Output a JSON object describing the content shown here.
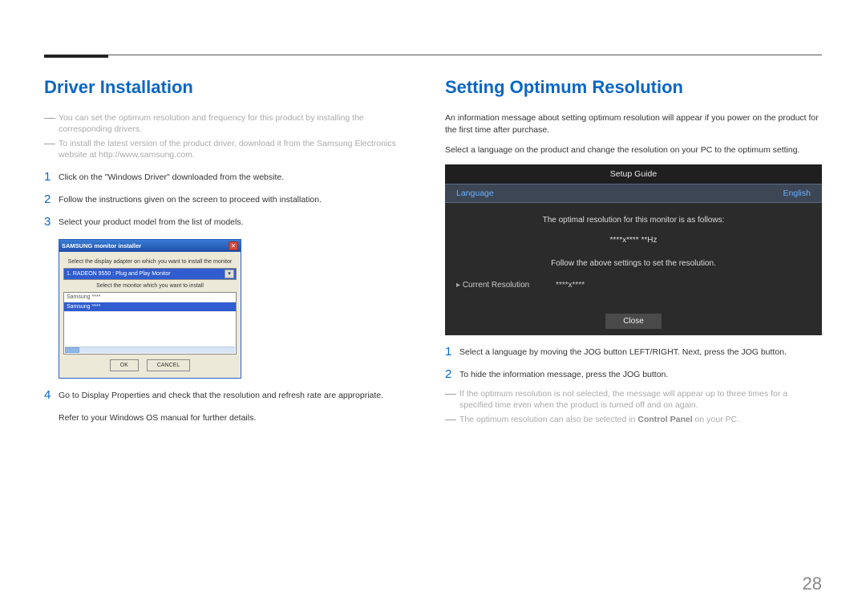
{
  "left": {
    "heading": "Driver Installation",
    "notes": [
      "You can set the optimum resolution and frequency for this product by installing the corresponding drivers.",
      "To install the latest version of the product driver, download it from the Samsung Electronics website at http://www.samsung.com."
    ],
    "steps123": [
      "Click on the \"Windows Driver\" downloaded from the website.",
      "Follow the instructions given on the screen to proceed with installation.",
      "Select your product model from the list of models."
    ],
    "installer": {
      "title": "SAMSUNG monitor installer",
      "prompt1": "Select the display adapter on which you want to install the monitor",
      "combo": "1. RADEON 9550 : Plug and Play Monitor",
      "prompt2": "Select the monitor which you want to install",
      "list_item0": "Samsung ****",
      "list_item1_sel": "Samsung ****",
      "btn_ok": "OK",
      "btn_cancel": "CANCEL"
    },
    "step4": "Go to Display Properties and check that the resolution and refresh rate are appropriate.",
    "refer": "Refer to your Windows OS manual for further details."
  },
  "right": {
    "heading": "Setting Optimum Resolution",
    "intro1": "An information message about setting optimum resolution will appear if you power on the product for the first time after purchase.",
    "intro2": "Select a language on the product and change the resolution on your PC to the optimum setting.",
    "osd": {
      "title": "Setup Guide",
      "lang_label": "Language",
      "lang_value": "English",
      "info": "The optimal resolution for this monitor is as follows:",
      "res": "****x**** **Hz",
      "follow": "Follow the above settings to set the resolution.",
      "cr_label": "Current Resolution",
      "cr_value": "****x****",
      "close": "Close"
    },
    "steps": [
      "Select a language by moving the JOG button LEFT/RIGHT. Next, press the JOG button.",
      "To hide the information message, press the JOG button."
    ],
    "post_notes": [
      "If the optimum resolution is not selected, the message will appear up to three times for a specified time even when the product is turned off and on again.",
      "The optimum resolution can also be selected in Control Panel on your PC."
    ]
  },
  "page": "28"
}
